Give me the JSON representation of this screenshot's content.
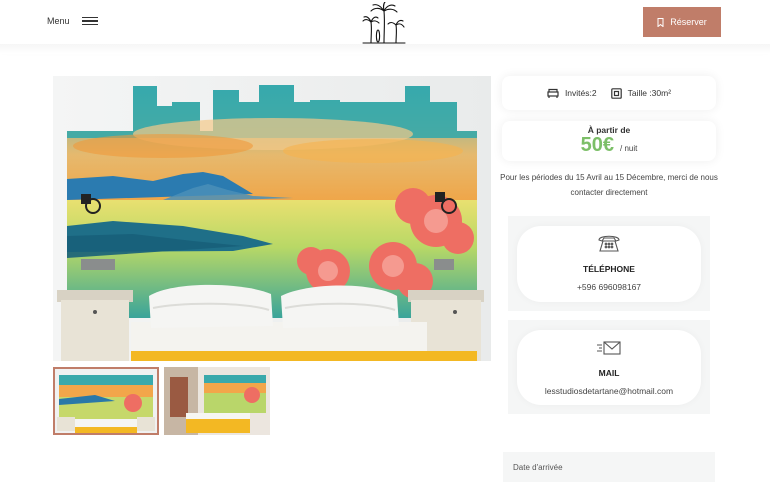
{
  "header": {
    "menu_label": "Menu",
    "reserve_label": "Réserver"
  },
  "gallery": {
    "main_image": "hotel-room-painted-headboard",
    "thumbnails": [
      "room-view-1",
      "room-view-2"
    ]
  },
  "specs": {
    "guests_label": "Invités:2",
    "size_label": "Taille :30m²"
  },
  "price": {
    "from_label": "À partir de",
    "amount": "50€",
    "unit": "/ nuit",
    "note": "Pour les périodes du 15 Avril au 15 Décembre, merci de nous contacter directement"
  },
  "contact": {
    "phone_title": "TÉLÉPHONE",
    "phone_value": "+596 696098167",
    "mail_title": "MAIL",
    "mail_value": "lesstudiosdetartane@hotmail.com"
  },
  "colors": {
    "accent": "#c07d69",
    "price_green": "#7cbf68"
  },
  "extra_label": "Date d'arrivée"
}
